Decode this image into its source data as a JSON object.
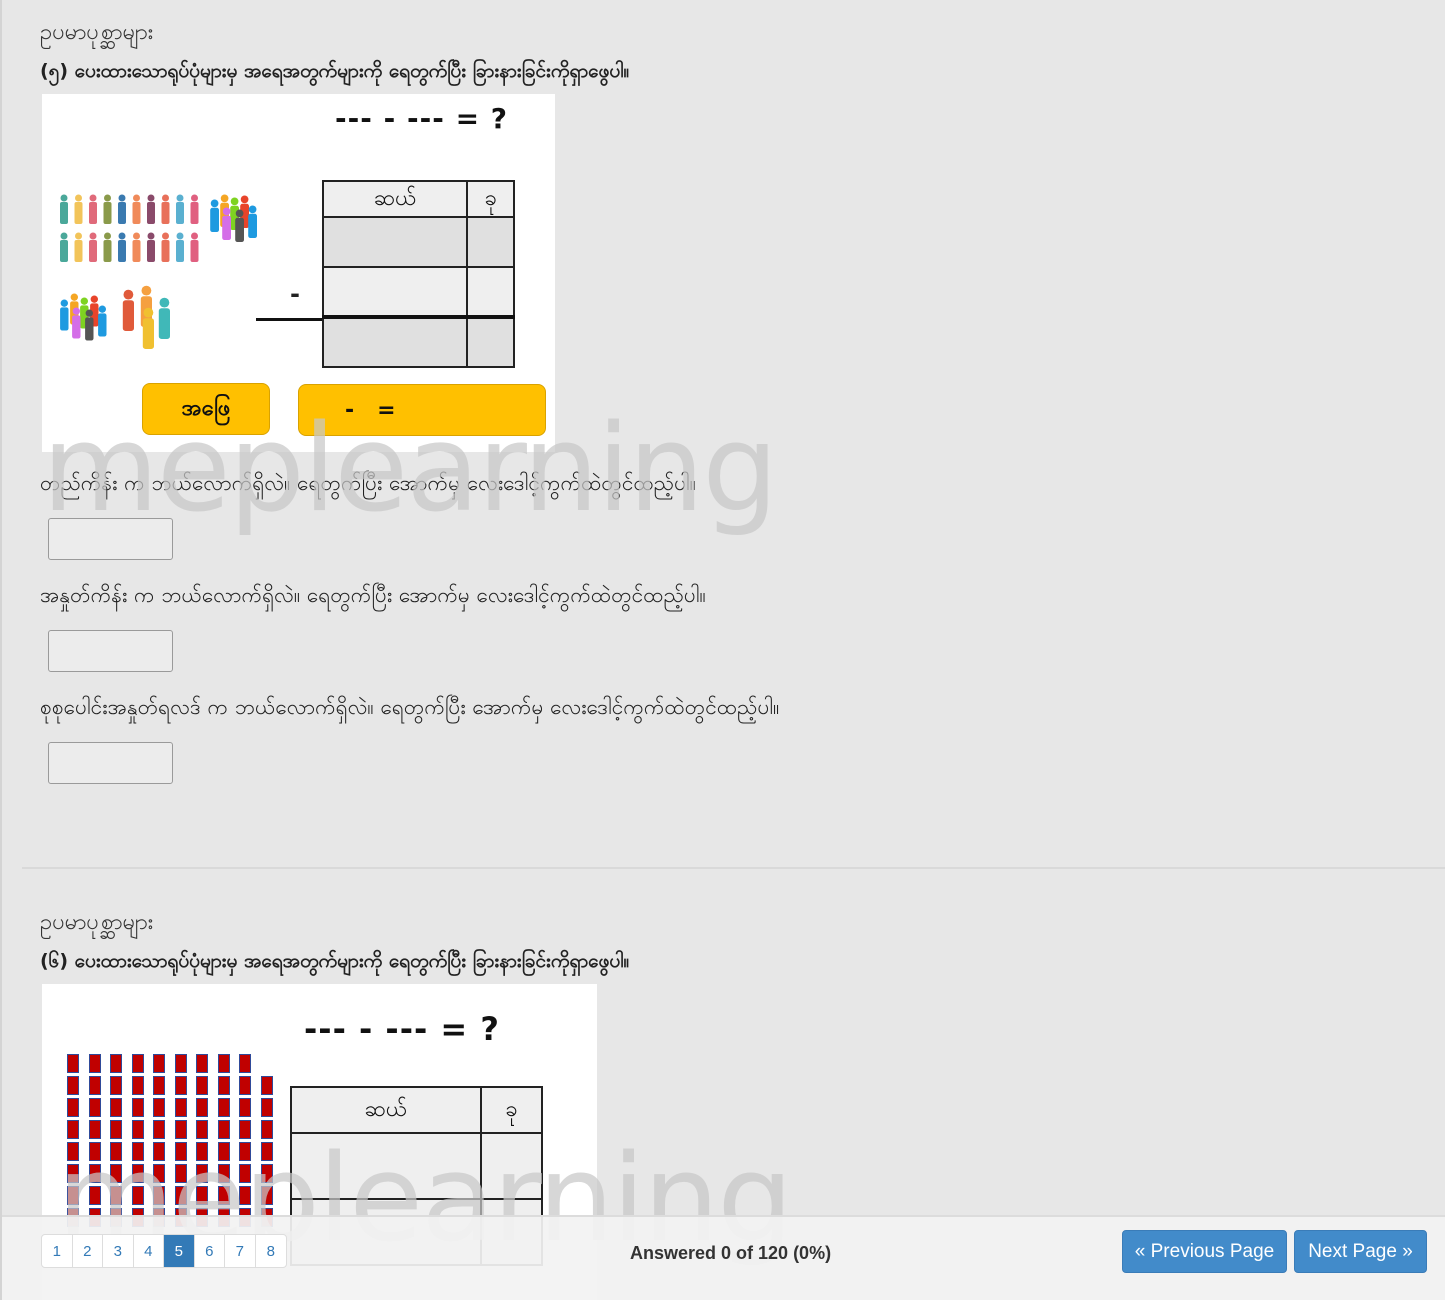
{
  "questions": [
    {
      "section_title": "ဥပမာပုစ္ဆာများ",
      "instruction": "(၅) ပေးထားသောရုပ်ပုံများမှ အရေအတွက်များကို ရေတွက်ပြီး ခြားနားခြင်းကိုရှာဖွေပါ။",
      "figure": {
        "equation": "--- - --- = ?",
        "table_headers": [
          "ဆယ်",
          "ခု"
        ],
        "minus": "-",
        "answer_label": "အဖြေ",
        "answer_expression": "-   ="
      },
      "prompts": [
        {
          "text": "တည်ကိန်း က ဘယ်လောက်ရှိလဲ။ ရေတွက်ပြီး အောက်မှ လေးဒေါင့်ကွက်ထဲတွင်ထည့်ပါ။",
          "value": ""
        },
        {
          "text": "အနှုတ်ကိန်း က ဘယ်လောက်ရှိလဲ။ ရေတွက်ပြီး အောက်မှ လေးဒေါင့်ကွက်ထဲတွင်ထည့်ပါ။",
          "value": ""
        },
        {
          "text": "စုစုပေါင်းအနှုတ်ရလဒ် က ဘယ်လောက်ရှိလဲ။ ရေတွက်ပြီး အောက်မှ လေးဒေါင့်ကွက်ထဲတွင်ထည့်ပါ။",
          "value": ""
        }
      ]
    },
    {
      "section_title": "ဥပမာပုစ္ဆာများ",
      "instruction": "(၆) ပေးထားသောရုပ်ပုံများမှ အရေအတွက်များကို ရေတွက်ပြီး ခြားနားခြင်းကိုရှာဖွေပါ။",
      "figure": {
        "equation": "--- - --- = ?",
        "table_headers": [
          "ဆယ်",
          "ခု"
        ]
      }
    }
  ],
  "watermark": "meplearning",
  "footer": {
    "pages": [
      "1",
      "2",
      "3",
      "4",
      "5",
      "6",
      "7",
      "8"
    ],
    "current_page": "5",
    "progress_text": "Answered 0 of 120 (0%)",
    "answered": 0,
    "total": 120,
    "prev_label": "« Previous Page",
    "next_label": "Next Page »"
  }
}
